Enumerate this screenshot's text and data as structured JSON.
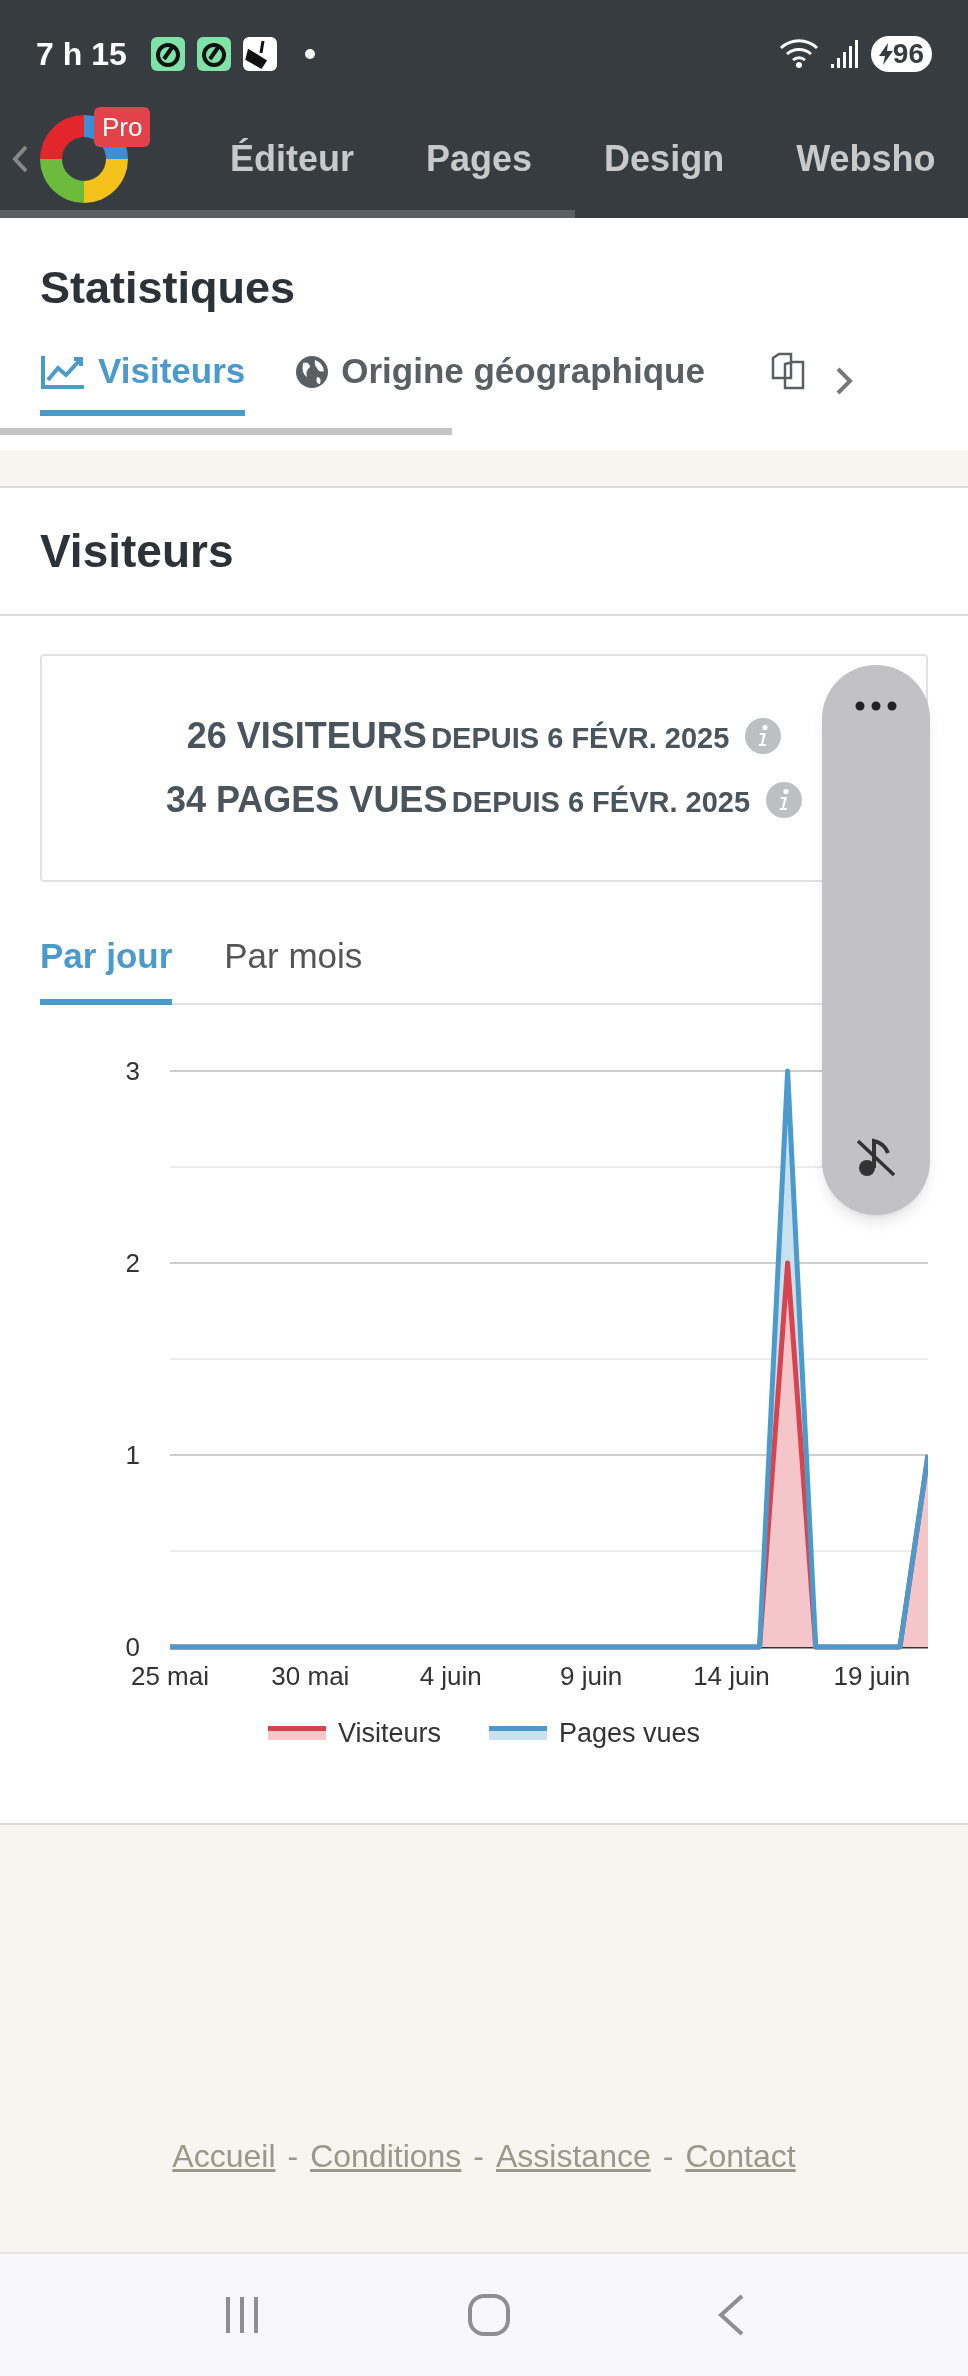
{
  "status_bar": {
    "time": "7 h 15",
    "battery": "96"
  },
  "app_nav": {
    "badge": "Pro",
    "items": [
      "Éditeur",
      "Pages",
      "Design",
      "Websho"
    ]
  },
  "page_title": "Statistiques",
  "stat_tabs": [
    {
      "label": "Visiteurs",
      "selected": true
    },
    {
      "label": "Origine géographique",
      "selected": false
    }
  ],
  "section_title": "Visiteurs",
  "summary": [
    {
      "count": "26 VISITEURS",
      "since": "DEPUIS 6 FÉVR. 2025"
    },
    {
      "count": "34 PAGES VUES",
      "since": "DEPUIS 6 FÉVR. 2025"
    }
  ],
  "period_tabs": [
    {
      "label": "Par jour",
      "selected": true
    },
    {
      "label": "Par mois",
      "selected": false
    }
  ],
  "chart_data": {
    "type": "area",
    "categories": [
      "25 mai",
      null,
      null,
      null,
      null,
      "30 mai",
      null,
      null,
      null,
      null,
      "4 juin",
      null,
      null,
      null,
      null,
      "9 juin",
      null,
      null,
      null,
      null,
      "14 juin",
      null,
      null,
      null,
      null,
      "19 juin",
      null,
      null
    ],
    "yticks": [
      0,
      1,
      2,
      3
    ],
    "ylim": [
      0,
      3
    ],
    "legend": "bottom",
    "series": [
      {
        "name": "Pages vues",
        "color": "#4a9acb",
        "values": [
          0,
          0,
          0,
          0,
          0,
          0,
          0,
          0,
          0,
          0,
          0,
          0,
          0,
          0,
          0,
          0,
          0,
          0,
          0,
          0,
          0,
          0,
          3,
          0,
          0,
          0,
          0,
          1
        ]
      },
      {
        "name": "Visiteurs",
        "color": "#d9434e",
        "values": [
          0,
          0,
          0,
          0,
          0,
          0,
          0,
          0,
          0,
          0,
          0,
          0,
          0,
          0,
          0,
          0,
          0,
          0,
          0,
          0,
          0,
          0,
          2,
          0,
          0,
          0,
          0,
          1
        ]
      }
    ]
  },
  "footer": {
    "links": [
      "Accueil",
      "Conditions",
      "Assistance",
      "Contact"
    ],
    "separator": "-"
  }
}
